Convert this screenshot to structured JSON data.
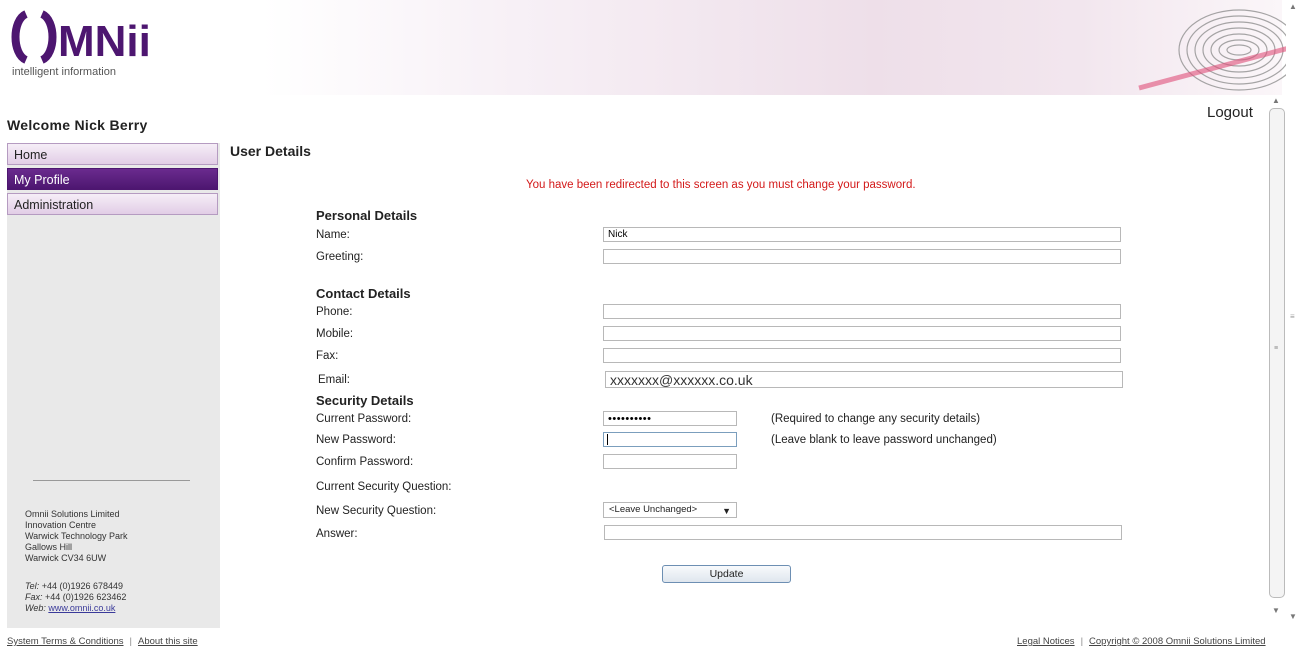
{
  "header": {
    "logo_text": "OMNii",
    "logo_tagline": "intelligent information"
  },
  "colors": {
    "brand_purple": "#4d1670",
    "alert_red": "#d31919"
  },
  "welcome": "Welcome Nick Berry",
  "logout_label": "Logout",
  "nav": {
    "items": [
      {
        "label": "Home",
        "active": false
      },
      {
        "label": "My Profile",
        "active": true
      },
      {
        "label": "Administration",
        "active": false
      }
    ]
  },
  "company": {
    "lines": [
      "Omnii Solutions Limited",
      "Innovation Centre",
      "Warwick Technology Park",
      "Gallows Hill",
      "Warwick CV34 6UW"
    ],
    "tel_label": "Tel:",
    "tel_value": "+44 (0)1926 678449",
    "fax_label": "Fax:",
    "fax_value": "+44 (0)1926 623462",
    "web_label": "Web:",
    "web_value": "www.omnii.co.uk"
  },
  "main": {
    "title": "User Details",
    "redirect_message": "You have been redirected to this screen as you must change your password.",
    "personal": {
      "heading": "Personal Details",
      "name_label": "Name:",
      "name_value": "Nick",
      "greeting_label": "Greeting:",
      "greeting_value": ""
    },
    "contact": {
      "heading": "Contact Details",
      "phone_label": "Phone:",
      "phone_value": "",
      "mobile_label": "Mobile:",
      "mobile_value": "",
      "fax_label": "Fax:",
      "fax_value": "",
      "email_label": "Email:",
      "email_value": "xxxxxxx@xxxxxx.co.uk"
    },
    "security": {
      "heading": "Security Details",
      "current_password_label": "Current Password:",
      "current_password_value": "••••••••••",
      "current_password_note": "(Required to change any security details)",
      "new_password_label": "New Password:",
      "new_password_note": "(Leave blank to leave password unchanged)",
      "confirm_password_label": "Confirm Password:",
      "current_question_label": "Current Security Question:",
      "new_question_label": "New Security Question:",
      "new_question_selected": "<Leave Unchanged>",
      "answer_label": "Answer:"
    },
    "update_label": "Update"
  },
  "footer": {
    "terms": "System Terms & Conditions",
    "about": "About this site",
    "legal": "Legal Notices",
    "copyright": "Copyright © 2008 Omnii Solutions Limited",
    "separator": "|"
  }
}
